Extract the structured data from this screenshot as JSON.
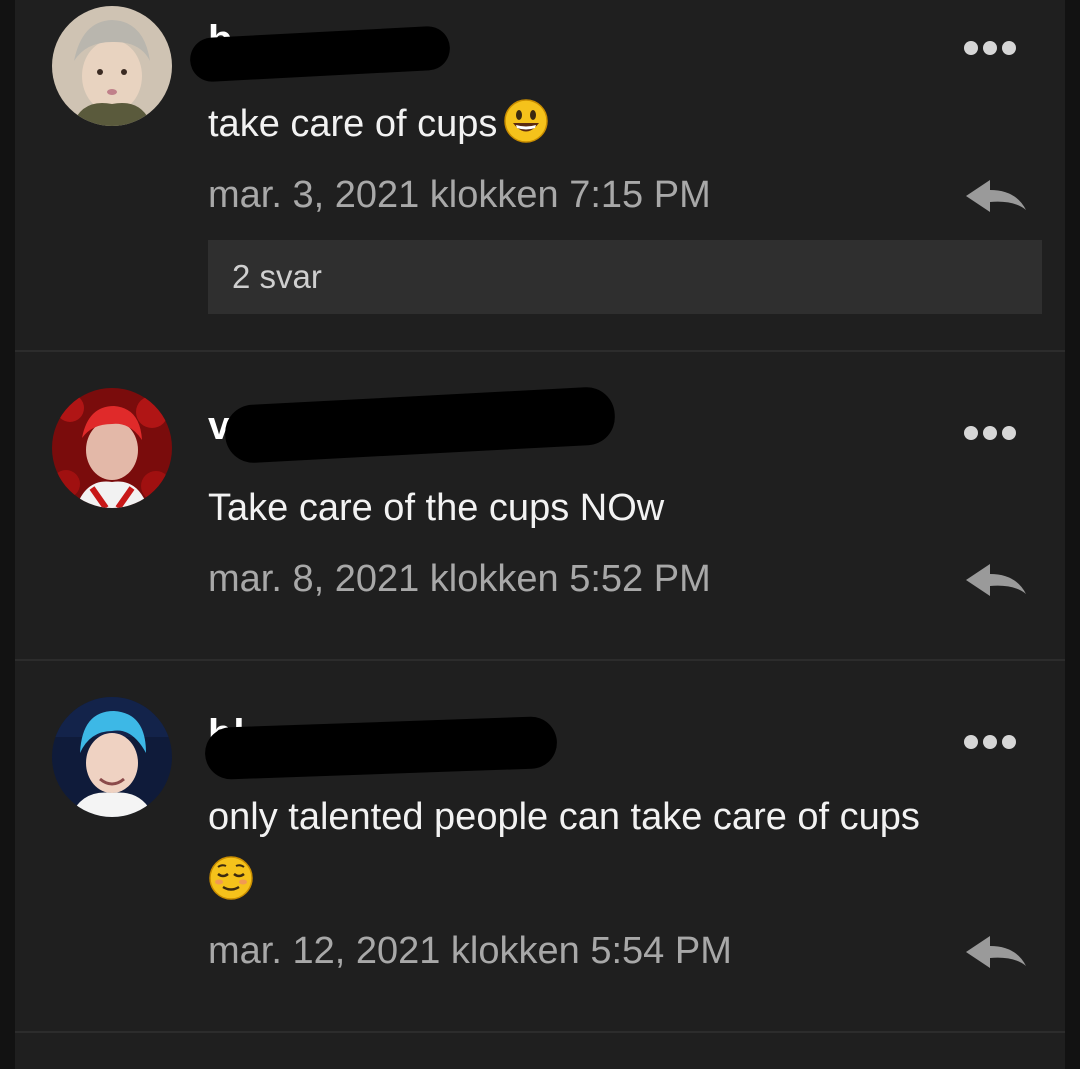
{
  "comments": [
    {
      "username": "b",
      "text": "take care of cups",
      "emoji": "smiling-face-icon",
      "date": "mar. 3, 2021 klokken 7:15 PM",
      "replies_label": "2 svar"
    },
    {
      "username": "v",
      "text": "Take care of the cups NOw",
      "date": "mar. 8, 2021 klokken 5:52 PM"
    },
    {
      "username": "bl",
      "text": "only talented people can take care of cups",
      "emoji": "relieved-face-icon",
      "date": "mar. 12, 2021 klokken 5:54 PM"
    }
  ],
  "icons": {
    "more": "more-options-icon",
    "reply": "reply-arrow-icon"
  },
  "colors": {
    "background": "#1f1f1f",
    "text": "#f2f2f2",
    "date": "#a8a8a8",
    "replies_bar": "#2f2f2f"
  }
}
